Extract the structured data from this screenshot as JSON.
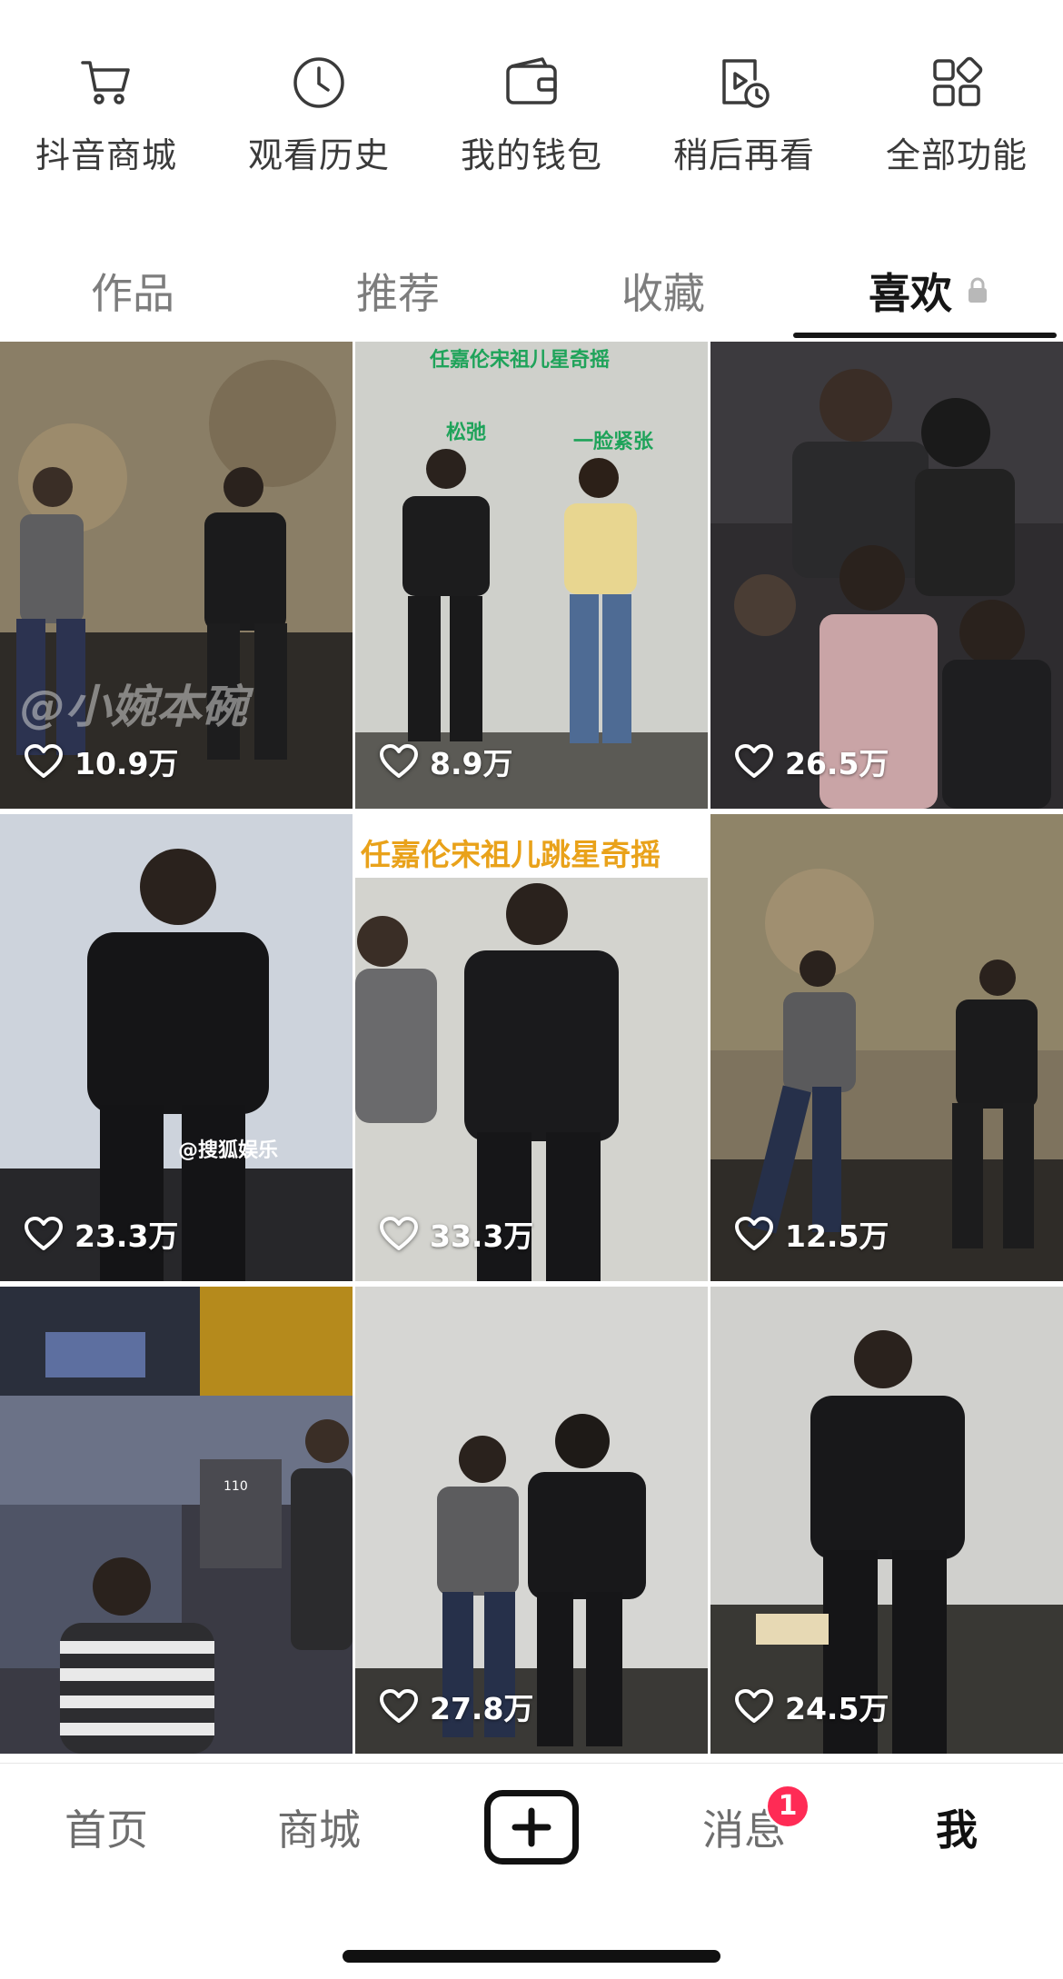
{
  "quick_functions": [
    {
      "label": "抖音商城",
      "icon": "cart-icon"
    },
    {
      "label": "观看历史",
      "icon": "clock-icon"
    },
    {
      "label": "我的钱包",
      "icon": "wallet-icon"
    },
    {
      "label": "稍后再看",
      "icon": "watch-later-icon"
    },
    {
      "label": "全部功能",
      "icon": "all-functions-icon"
    }
  ],
  "tabs": [
    {
      "label": "作品",
      "active": false
    },
    {
      "label": "推荐",
      "active": false
    },
    {
      "label": "收藏",
      "active": false
    },
    {
      "label": "喜欢",
      "active": true,
      "icon": "lock-icon"
    }
  ],
  "videos": [
    {
      "likes": "10.9万",
      "overlay": "@小婉本碗"
    },
    {
      "likes": "8.9万",
      "overlay_title": "任嘉伦宋祖儿星奇摇",
      "overlay_left": "松弛",
      "overlay_right": "一脸紧张"
    },
    {
      "likes": "26.5万"
    },
    {
      "likes": "23.3万",
      "overlay": "@搜狐娱乐"
    },
    {
      "likes": "33.3万",
      "overlay_title": "任嘉伦宋祖儿跳星奇摇"
    },
    {
      "likes": "12.5万"
    },
    {
      "likes": "",
      "overlay": "110"
    },
    {
      "likes": "27.8万"
    },
    {
      "likes": "24.5万"
    }
  ],
  "bottom_nav": {
    "home": "首页",
    "mall": "商城",
    "create_icon": "plus-icon",
    "messages": "消息",
    "messages_badge": "1",
    "me": "我"
  },
  "colors": {
    "active_text": "#161616",
    "inactive_text": "#7d7d7d",
    "badge": "#ff2b55",
    "overlay_green": "#1fa35a"
  }
}
